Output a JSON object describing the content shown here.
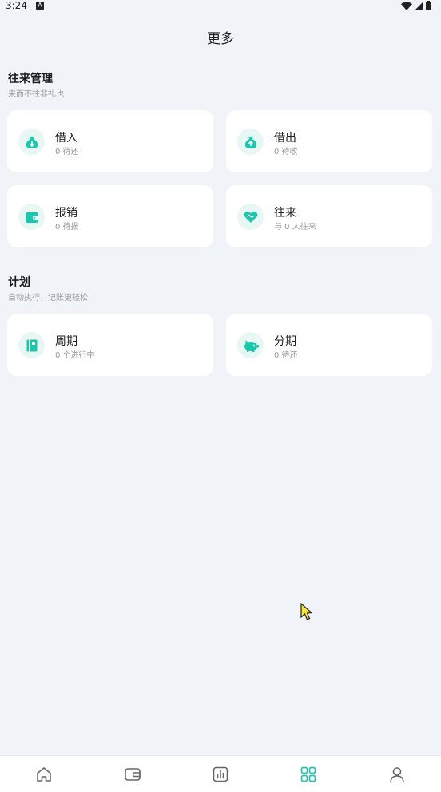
{
  "status": {
    "time": "3:24",
    "notif": "A"
  },
  "page": {
    "title": "更多"
  },
  "sections": [
    {
      "title": "往来管理",
      "subtitle": "来而不往非礼也",
      "cards": [
        {
          "title": "借入",
          "sub": "0 待还",
          "icon": "money-bag-down-icon"
        },
        {
          "title": "借出",
          "sub": "0 待收",
          "icon": "money-bag-up-icon"
        },
        {
          "title": "报销",
          "sub": "0 待报",
          "icon": "wallet-icon"
        },
        {
          "title": "往来",
          "sub": "与 0 人往来",
          "icon": "handshake-heart-icon"
        }
      ]
    },
    {
      "title": "计划",
      "subtitle": "自动执行，记账更轻松",
      "cards": [
        {
          "title": "周期",
          "sub": "0 个进行中",
          "icon": "notebook-icon"
        },
        {
          "title": "分期",
          "sub": "0 待还",
          "icon": "piggy-bank-icon"
        }
      ]
    }
  ],
  "tabs": [
    {
      "name": "home",
      "icon": "home-icon"
    },
    {
      "name": "wallet",
      "icon": "wallet-icon"
    },
    {
      "name": "stats",
      "icon": "chart-icon"
    },
    {
      "name": "more",
      "icon": "grid-icon",
      "active": true
    },
    {
      "name": "profile",
      "icon": "user-icon"
    }
  ],
  "colors": {
    "accent": "#1cc6ad",
    "icon_bg": "#e7f7f4",
    "background": "#f0f3f8",
    "tab_inactive": "#666666"
  }
}
